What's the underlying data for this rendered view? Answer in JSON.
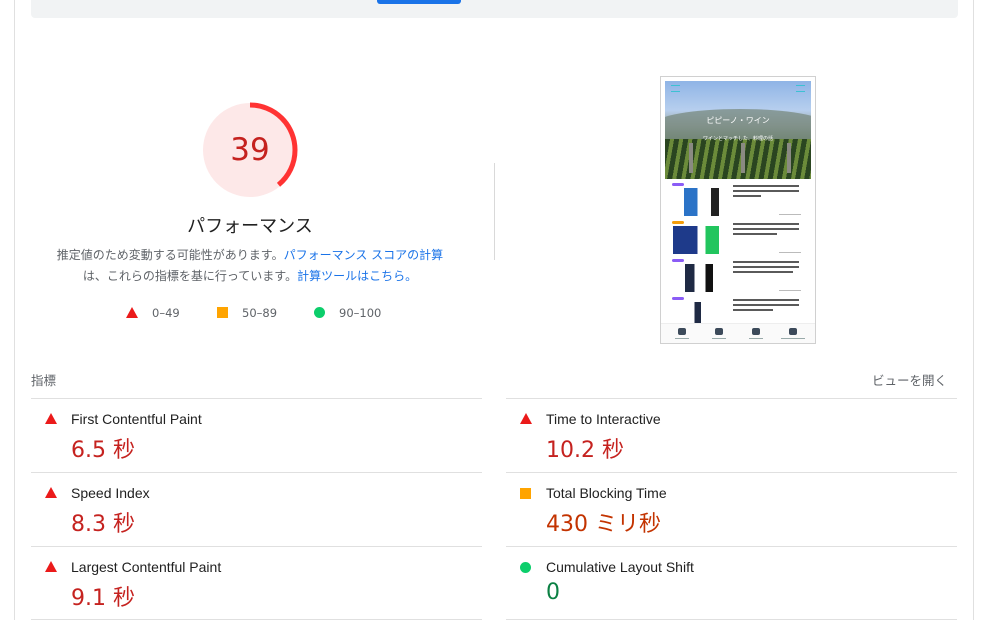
{
  "gauge": {
    "score": "39",
    "title": "パフォーマンス",
    "score_fraction": 0.39,
    "color": "#ff3333"
  },
  "description": {
    "text_before": "推定値のため変動する可能性があります。",
    "link1": "パフォーマンス スコアの計算",
    "text_middle": "は、これらの指標を基に行っています。",
    "link2": "計算ツールはこちら。"
  },
  "legend": [
    {
      "label": "0–49",
      "icon": "triangle-icon",
      "color": "#eb1a1a"
    },
    {
      "label": "50–89",
      "icon": "square-icon",
      "color": "#ffa400"
    },
    {
      "label": "90–100",
      "icon": "circle-icon",
      "color": "#0cce6b"
    }
  ],
  "thumbnail": {
    "site_title": "ピピーノ・ワイン",
    "subtitle": "ワインとマッチした、料理の話"
  },
  "metrics": {
    "header": "指標",
    "expand_label": "ビューを開く",
    "items": [
      {
        "name": "First Contentful Paint",
        "value": "6.5 秒",
        "rating": "fail"
      },
      {
        "name": "Time to Interactive",
        "value": "10.2 秒",
        "rating": "fail"
      },
      {
        "name": "Speed Index",
        "value": "8.3 秒",
        "rating": "fail"
      },
      {
        "name": "Total Blocking Time",
        "value": "430 ミリ秒",
        "rating": "average"
      },
      {
        "name": "Largest Contentful Paint",
        "value": "9.1 秒",
        "rating": "fail"
      },
      {
        "name": "Cumulative Layout Shift",
        "value": "0",
        "rating": "pass"
      }
    ]
  }
}
